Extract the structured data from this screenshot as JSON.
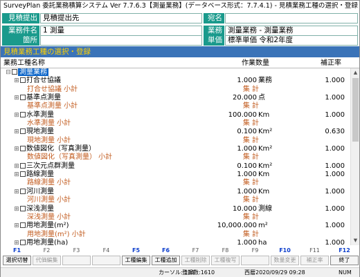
{
  "window": {
    "title": "SurveyPlan 委託業務積算システム Ver 7.7.6.3【測量業務】(データベース形式：7.7.4.1) - 見積業務工種の選択・登録",
    "pin": "*"
  },
  "header": {
    "estimate_to_label": "見積提出先",
    "estimate_to_value": "見積提出先",
    "recipient_label": "宛名",
    "recipient_value": "",
    "project_label": "業務件名",
    "project_value": "1 測量",
    "work_label": "業務",
    "work_value": "測量業務 - 測量業務",
    "location_label": "箇所",
    "location_value": "",
    "unit_price_label": "単価",
    "unit_price_value": "標準単価 令和2年度"
  },
  "section_title": "見積業務工種の選択・登録",
  "columns": {
    "name": "業務工種名称",
    "quantity": "作業数量",
    "rate": "補正率"
  },
  "rows": [
    {
      "type": "root",
      "tree": "⊟",
      "name": "測量業務",
      "qty": "",
      "unit": "",
      "rate": ""
    },
    {
      "type": "item",
      "tree": "⊞",
      "name": "打合せ協議",
      "qty": "1.000",
      "unit": "業務",
      "rate": "1.000"
    },
    {
      "type": "sub",
      "tree": "",
      "name": "打合せ協議 小計",
      "qty": "集 計",
      "unit": "",
      "rate": ""
    },
    {
      "type": "item",
      "tree": "⊞",
      "name": "基準点測量",
      "qty": "20.000",
      "unit": "点",
      "rate": "1.000"
    },
    {
      "type": "sub",
      "tree": "",
      "name": "基準点測量 小計",
      "qty": "集 計",
      "unit": "",
      "rate": ""
    },
    {
      "type": "item",
      "tree": "⊞",
      "name": "水準測量",
      "qty": "100.000",
      "unit": "Km",
      "rate": "1.000"
    },
    {
      "type": "sub",
      "tree": "",
      "name": "水準測量 小計",
      "qty": "集 計",
      "unit": "",
      "rate": ""
    },
    {
      "type": "item",
      "tree": "⊞",
      "name": "現地測量",
      "qty": "0.100",
      "unit": "Km²",
      "rate": "0.630"
    },
    {
      "type": "sub",
      "tree": "",
      "name": "現地測量 小計",
      "qty": "集 計",
      "unit": "",
      "rate": ""
    },
    {
      "type": "item",
      "tree": "⊞",
      "name": "数値図化（写真測量）",
      "qty": "1.000",
      "unit": "Km²",
      "rate": "1.000"
    },
    {
      "type": "sub",
      "tree": "",
      "name": "数値図化（写真測量） 小計",
      "qty": "集 計",
      "unit": "",
      "rate": ""
    },
    {
      "type": "item",
      "tree": "⊞",
      "name": "三次元点群測量",
      "qty": "0.100",
      "unit": "Km²",
      "rate": "1.000"
    },
    {
      "type": "item",
      "tree": "⊞",
      "name": "路線測量",
      "qty": "1.000",
      "unit": "Km",
      "rate": "1.000"
    },
    {
      "type": "sub",
      "tree": "",
      "name": "路線測量 小計",
      "qty": "集 計",
      "unit": "",
      "rate": ""
    },
    {
      "type": "item",
      "tree": "⊞",
      "name": "河川測量",
      "qty": "1.000",
      "unit": "Km",
      "rate": "1.000"
    },
    {
      "type": "sub",
      "tree": "",
      "name": "河川測量 小計",
      "qty": "集 計",
      "unit": "",
      "rate": ""
    },
    {
      "type": "item",
      "tree": "⊞",
      "name": "深浅測量",
      "qty": "10.000",
      "unit": "測線",
      "rate": "1.000"
    },
    {
      "type": "sub",
      "tree": "",
      "name": "深浅測量 小計",
      "qty": "集 計",
      "unit": "",
      "rate": ""
    },
    {
      "type": "item",
      "tree": "⊞",
      "name": "用地測量(m²)",
      "qty": "10,000.000",
      "unit": "m²",
      "rate": "1.000"
    },
    {
      "type": "sub",
      "tree": "",
      "name": "用地測量(m²) 小計",
      "qty": "集 計",
      "unit": "",
      "rate": ""
    },
    {
      "type": "item",
      "tree": "⊞",
      "name": "用地測量(ha)",
      "qty": "1.000",
      "unit": "ha",
      "rate": "1.000"
    },
    {
      "type": "sub",
      "tree": "",
      "name": "用地測量(ha) 小計",
      "qty": "集 計",
      "unit": "",
      "rate": ""
    }
  ],
  "fkeys": [
    "F1",
    "F2",
    "F3",
    "F4",
    "F5",
    "F6",
    "F7",
    "F8",
    "F9",
    "F10",
    "F11",
    "F12"
  ],
  "fkeys_active": [
    true,
    false,
    false,
    false,
    true,
    true,
    false,
    false,
    false,
    true,
    false,
    true
  ],
  "fbuttons": [
    {
      "label": "選択切替",
      "enabled": true
    },
    {
      "label": "代価編集",
      "enabled": false
    },
    {
      "label": "",
      "enabled": false
    },
    {
      "label": "",
      "enabled": false
    },
    {
      "label": "工種編集",
      "enabled": true
    },
    {
      "label": "工種追加",
      "enabled": true
    },
    {
      "label": "工種削除",
      "enabled": false
    },
    {
      "label": "工種複写",
      "enabled": false
    },
    {
      "label": "",
      "enabled": false
    },
    {
      "label": "数量変更",
      "enabled": false
    },
    {
      "label": "補正率",
      "enabled": false
    },
    {
      "label": "終了",
      "enabled": true
    }
  ],
  "status": {
    "cursor": "カーソル: 131",
    "records": "登録数:1610",
    "date": "西暦2020/09/29 09:28",
    "num": "NUM"
  }
}
